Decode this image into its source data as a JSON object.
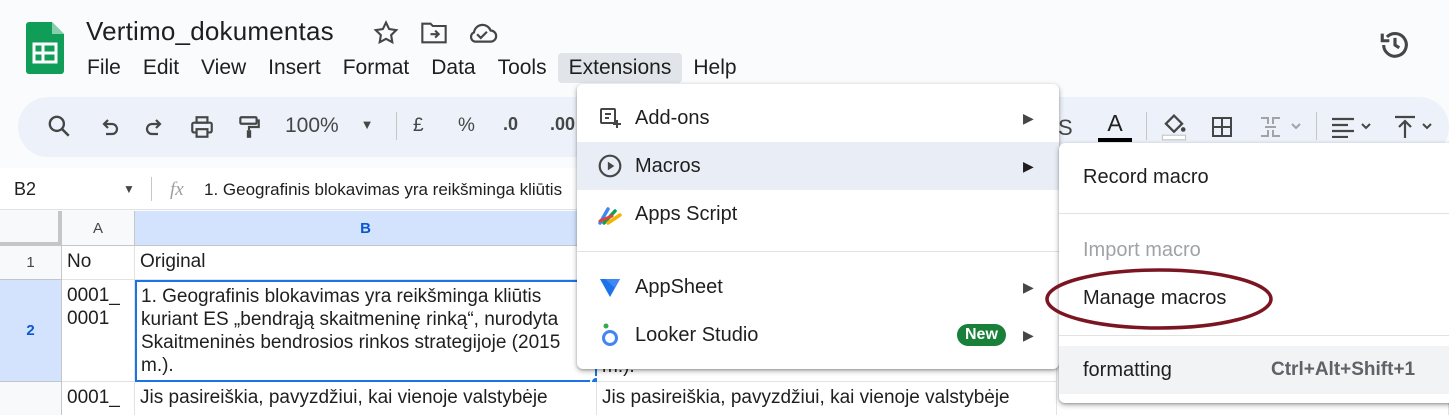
{
  "doc": {
    "title": "Vertimo_dokumentas"
  },
  "menubar": [
    "File",
    "Edit",
    "View",
    "Insert",
    "Format",
    "Data",
    "Tools",
    "Extensions",
    "Help"
  ],
  "toolbar": {
    "zoom": "100%",
    "currency": "£",
    "percent": "%",
    "dec_decrease": ".0",
    "dec_increase": ".00"
  },
  "formula_bar": {
    "cell_ref": "B2",
    "fx": "fx",
    "content": "1. Geografinis blokavimas yra reikšminga kliūtis"
  },
  "grid": {
    "columns": [
      "A",
      "B"
    ],
    "rows": [
      {
        "num": "1",
        "a": "No",
        "b": "Original",
        "c": ""
      },
      {
        "num": "2",
        "a": "0001_\n0001",
        "b": "1. Geografinis blokavimas yra reikšminga kliūtis kuriant ES „bendrąją skaitmeninę rinką“, nurodyta Skaitmeninės bendrosios rinkos strategijoje (2015 m.).",
        "c": "m.)."
      },
      {
        "num": "",
        "a": "0001_",
        "b": "Jis pasireiškia, pavyzdžiui, kai vienoje valstybėje",
        "c": "Jis pasireiškia, pavyzdžiui, kai vienoje valstybėje"
      }
    ]
  },
  "extensions_menu": {
    "items": [
      {
        "label": "Add-ons",
        "icon": "add-ons-icon"
      },
      {
        "label": "Macros",
        "icon": "play-circle-icon"
      },
      {
        "label": "Apps Script",
        "icon": "apps-script-icon"
      },
      {
        "label": "AppSheet",
        "icon": "appsheet-icon"
      },
      {
        "label": "Looker Studio",
        "icon": "looker-studio-icon",
        "badge": "New"
      }
    ]
  },
  "macros_menu": {
    "record": "Record macro",
    "import": "Import macro",
    "manage": "Manage macros",
    "macro_name": "formatting",
    "macro_shortcut": "Ctrl+Alt+Shift+1"
  },
  "colors": {
    "sheets_green": "#0f9d58",
    "selection_blue": "#1a73e8",
    "new_badge": "#188038",
    "annotation_circle": "#7b1522"
  }
}
